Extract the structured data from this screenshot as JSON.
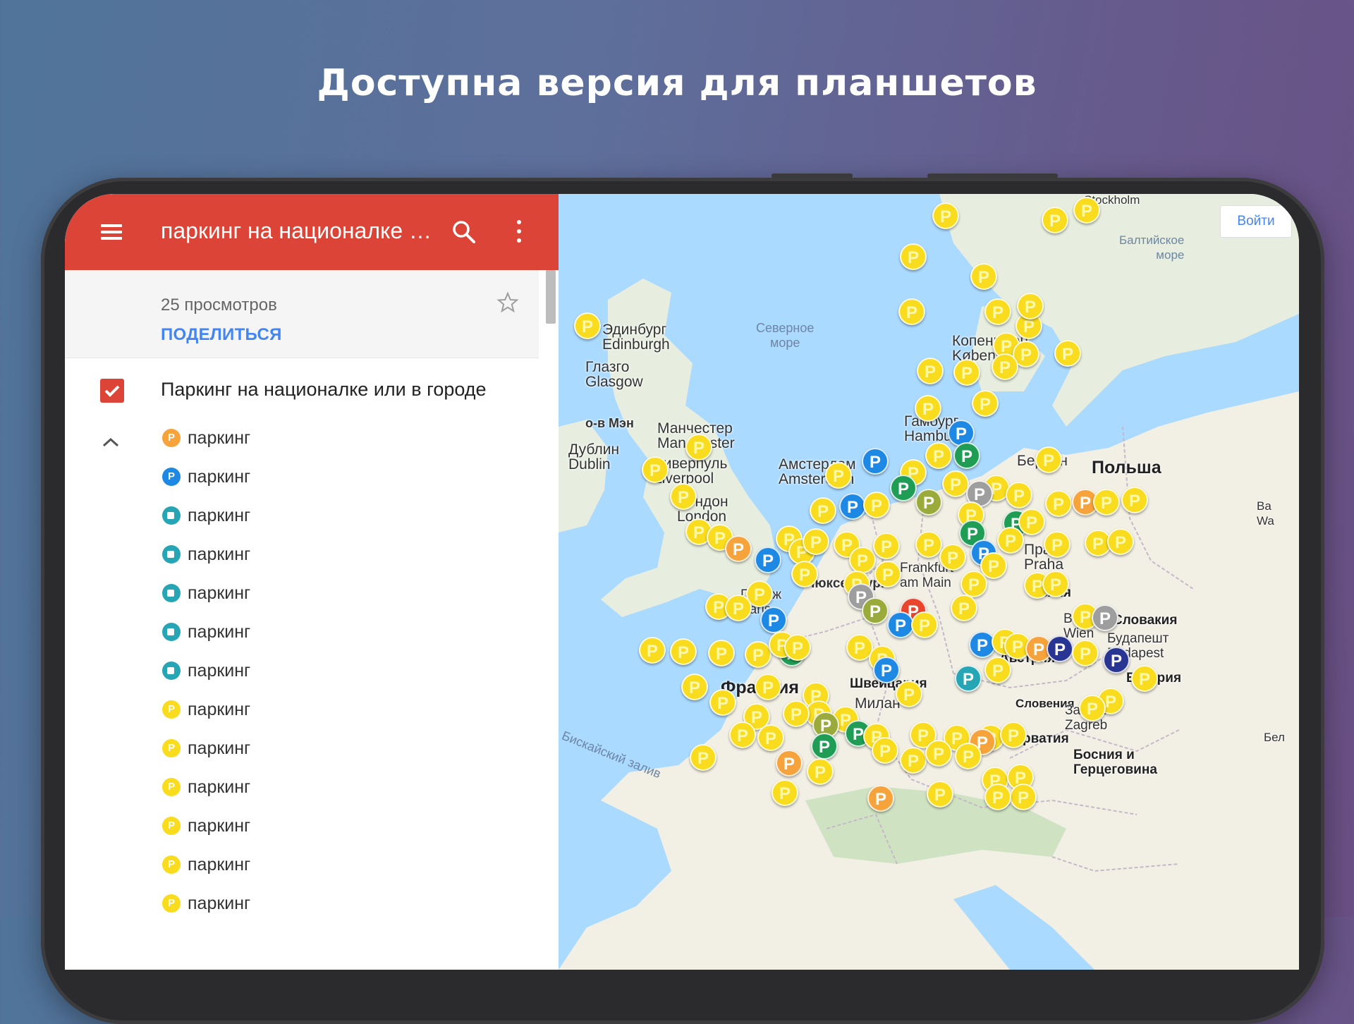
{
  "headline": "Доступна версия для планшетов",
  "appbar": {
    "title": "паркинг на националке или в городе"
  },
  "info": {
    "views": "25 просмотров",
    "share": "ПОДЕЛИТЬСЯ"
  },
  "layer": {
    "title": "Паркинг на националке или в городе",
    "checked": true
  },
  "legend": [
    {
      "label": "паркинг",
      "icon": "parking-orange-icon",
      "color": "#f6a33b"
    },
    {
      "label": "паркинг",
      "icon": "parking-blue-icon",
      "color": "#1e88e5"
    },
    {
      "label": "паркинг",
      "icon": "camera-teal-icon",
      "color": "#26a5b5"
    },
    {
      "label": "паркинг",
      "icon": "camera-teal-icon",
      "color": "#26a5b5"
    },
    {
      "label": "паркинг",
      "icon": "camera-teal-icon",
      "color": "#26a5b5"
    },
    {
      "label": "паркинг",
      "icon": "camera-teal-icon",
      "color": "#26a5b5"
    },
    {
      "label": "паркинг",
      "icon": "camera-teal-icon",
      "color": "#26a5b5"
    },
    {
      "label": "паркинг",
      "icon": "parking-yellow-icon",
      "color": "#f8dc1d"
    },
    {
      "label": "паркинг",
      "icon": "parking-yellow-icon",
      "color": "#f8dc1d"
    },
    {
      "label": "паркинг",
      "icon": "parking-yellow-icon",
      "color": "#f8dc1d"
    },
    {
      "label": "паркинг",
      "icon": "parking-yellow-icon",
      "color": "#f8dc1d"
    },
    {
      "label": "паркинг",
      "icon": "parking-yellow-icon",
      "color": "#f8dc1d"
    },
    {
      "label": "паркинг",
      "icon": "parking-yellow-icon",
      "color": "#f8dc1d"
    }
  ],
  "map": {
    "login": "Войти",
    "labels": {
      "edinburgh": "Эдинбург\nEdinburgh",
      "glasgow": "Глазго\nGlasgow",
      "north_sea": "Северное\nморе",
      "isle_of_man": "о-в Мэн",
      "dublin": "Дублин\nDublin",
      "manchester": "Манчестер\nManchester",
      "liverpool": "Ливерпуль\nLiverpool",
      "london": "Лондон\nLondon",
      "amsterdam": "Амстердам\nAmsterdam",
      "hamburg": "Гамбург\nHamburg",
      "berlin": "Берлин",
      "poland": "Польша",
      "copenhagen": "Копенгаген\nKøbenhavn",
      "stockholm": "Stockholm",
      "baltic": "Балтийское\nморе",
      "frankfurt": "Frankfurt\nam Main",
      "luxembourg": "Люксембург",
      "prague": "Прага\nPraha",
      "czechia": "Чехия",
      "paris": "Париж\nParis",
      "vienna": "Вена\nWien",
      "slovakia": "Словакия",
      "budapest": "Будапешт\nBudapest",
      "hungary": "Венгрия",
      "austria": "Австрия",
      "switzerland": "Швейцария",
      "france": "Франция",
      "milan": "Милан",
      "slovenia": "Словения",
      "zagreb": "Загреб\nZagreb",
      "croatia": "Хорватия",
      "bosnia": "Босния и\nГерцеговина",
      "biscay": "Бискайский залив",
      "warsaw": "Ва\nWa",
      "belgrade": "Бел"
    },
    "marker_colors": {
      "yellow": "#f8dc1d",
      "blue": "#1e88e5",
      "green": "#1f9d55",
      "orange": "#f6a33b",
      "olive": "#9aab3c",
      "navy": "#283593",
      "red": "#e8452c",
      "grey": "#9e9e9e",
      "teal": "#26a5b5"
    }
  }
}
